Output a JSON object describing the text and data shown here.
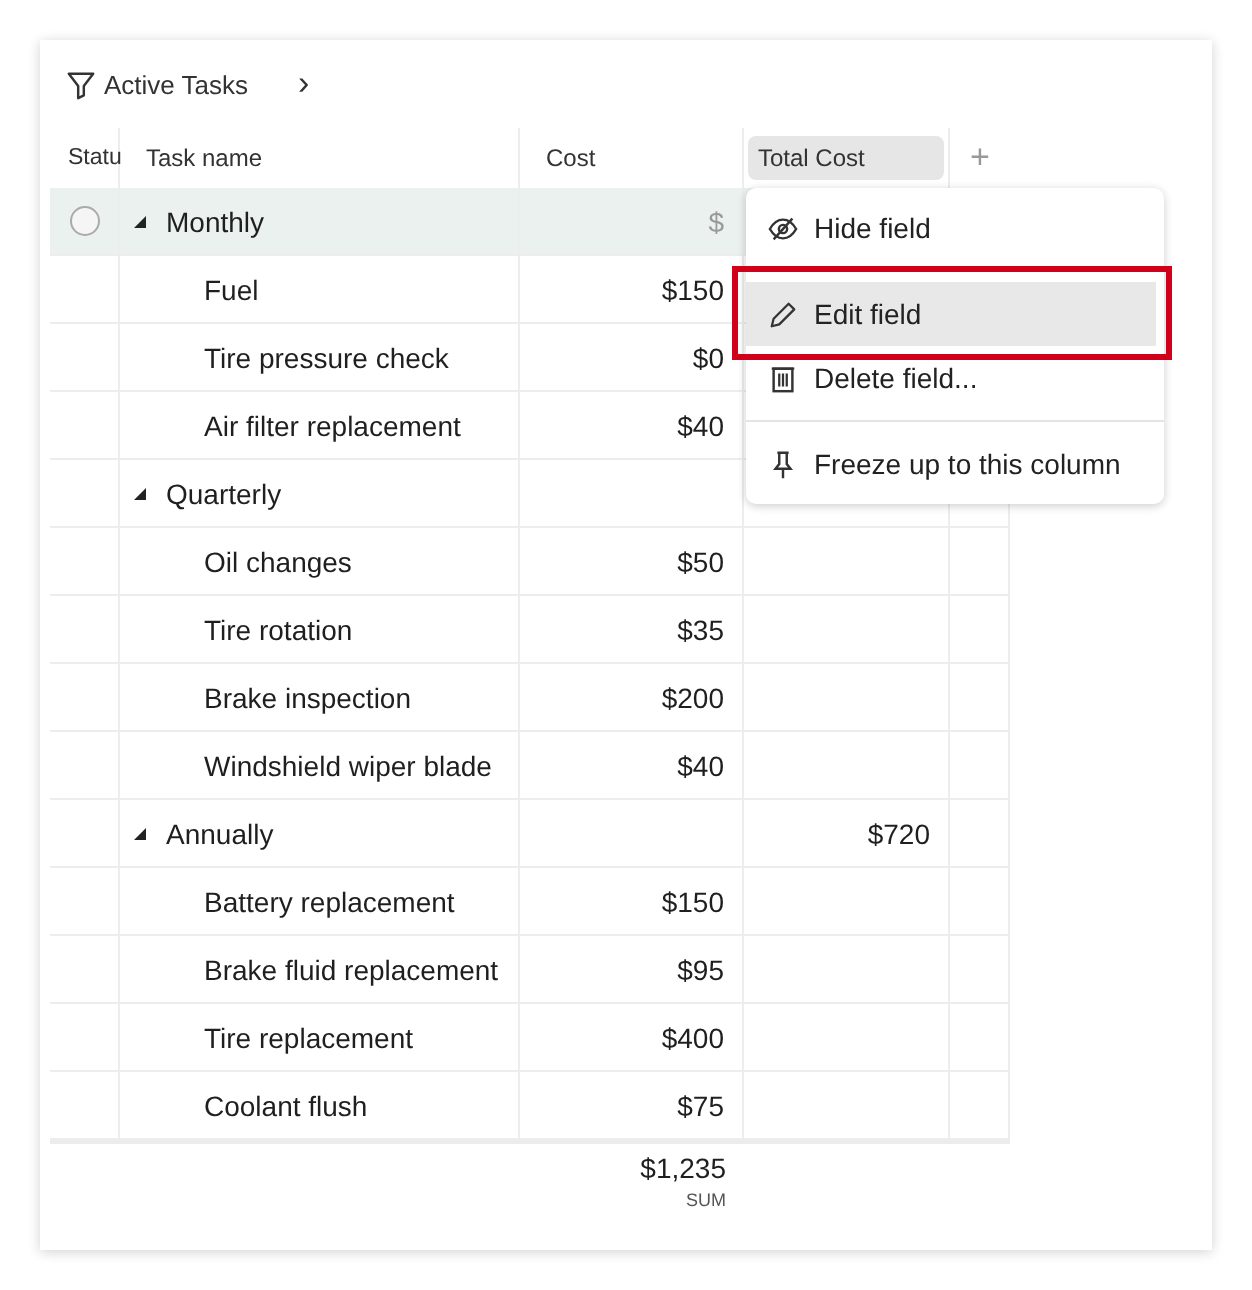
{
  "toolbar": {
    "view_name": "Active Tasks",
    "next": "›"
  },
  "table": {
    "columns": [
      {
        "label": "Statu",
        "selected": false
      },
      {
        "label": "Task name",
        "selected": false
      },
      {
        "label": "Cost",
        "selected": false
      },
      {
        "label": "Total Cost",
        "selected": true
      }
    ],
    "add_column": "+",
    "groups": [
      {
        "name": "Monthly",
        "expanded": true,
        "selected": true,
        "cost_field": {
          "placeholder": "$"
        },
        "rows": [
          {
            "name": "Fuel",
            "cost": "$150"
          },
          {
            "name": "Tire pressure check",
            "cost": "$0"
          },
          {
            "name": "Air filter replacement",
            "cost": "$40"
          }
        ]
      },
      {
        "name": "Quarterly",
        "expanded": true,
        "selected": false,
        "rows": [
          {
            "name": "Oil changes",
            "cost": "$50"
          },
          {
            "name": "Tire rotation",
            "cost": "$35"
          },
          {
            "name": "Brake inspection",
            "cost": "$200"
          },
          {
            "name": "Windshield wiper blade",
            "cost": "$40"
          }
        ]
      },
      {
        "name": "Annually",
        "expanded": true,
        "selected": false,
        "total": "$720",
        "rows": [
          {
            "name": "Battery replacement",
            "cost": "$150"
          },
          {
            "name": "Brake fluid replacement",
            "cost": "$95"
          },
          {
            "name": "Tire replacement",
            "cost": "$400"
          },
          {
            "name": "Coolant flush",
            "cost": "$75"
          }
        ]
      }
    ],
    "footer": {
      "sum": "$1,235",
      "sum_label": "SUM"
    }
  },
  "context_menu": {
    "sections": [
      [
        {
          "label": "Hide field",
          "kind": "hide",
          "selected": false,
          "highlighted": false
        }
      ],
      [
        {
          "label": "Edit field",
          "kind": "edit",
          "selected": true,
          "highlighted": true
        },
        {
          "label": "Delete field...",
          "kind": "delete",
          "selected": false,
          "highlighted": false
        }
      ],
      [
        {
          "label": "Freeze up to this column",
          "kind": "freeze",
          "selected": false,
          "highlighted": false
        }
      ]
    ]
  }
}
